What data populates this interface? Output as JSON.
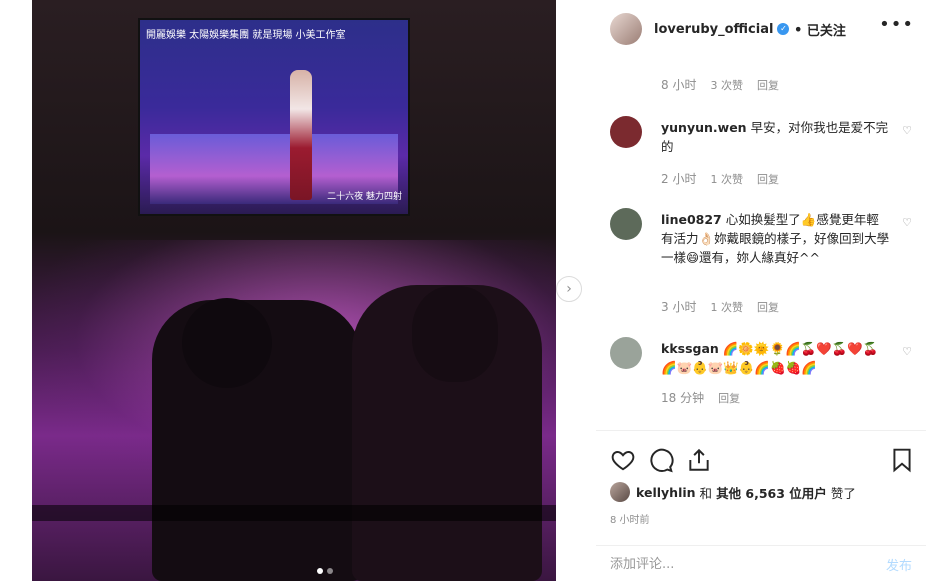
{
  "media": {
    "screen_caption": "開麗娛樂 太陽娛樂集團 就是現場 小美工作室",
    "screen_subtitle": "二十六夜 魅力四射",
    "carousel_next_icon": "chevron-right-icon",
    "carousel_dots": 2,
    "carousel_active_index": 0
  },
  "header": {
    "username": "loveruby_official",
    "bullet": "•",
    "follow_label": "已关注",
    "more_icon": "more-horizontal-icon"
  },
  "top_meta": {
    "time": "8 小时",
    "likes": "3 次赞",
    "reply": "回复"
  },
  "comments": [
    {
      "username": "yunyun.wen",
      "text": "早安，对你我也是爱不完的",
      "time": "2 小时",
      "likes": "1 次赞",
      "reply": "回复",
      "avatar_color": "#7b2a2f"
    },
    {
      "username": "line0827",
      "text": "心如换髮型了👍感覺更年輕有活力👌🏻妳戴眼鏡的樣子，好像回到大學一樣😄還有，妳人緣真好^^",
      "time": "3 小时",
      "likes": "1 次赞",
      "reply": "回复",
      "avatar_color": "#5d6a5a"
    },
    {
      "username": "kkssgan",
      "text": "🌈🌼🌞🌻🌈🍒❤️🍒❤️🍒🌈🐷👶🐷👑👶🌈🍓🍓🌈",
      "time": "18 分钟",
      "likes": "",
      "reply": "回复",
      "avatar_color": "#9aa39a"
    }
  ],
  "actions": {
    "like_icon": "heart-icon",
    "comment_icon": "comment-icon",
    "share_icon": "share-icon",
    "save_icon": "bookmark-icon"
  },
  "likes_summary": {
    "user": "kellyhlin",
    "connector": "和",
    "others": "其他 6,563 位用户",
    "suffix": "赞了"
  },
  "posted_time": "8 小时前",
  "comment_box": {
    "placeholder": "添加评论...",
    "publish_label": "发布"
  },
  "colors": {
    "verified": "#3897f0",
    "publish_disabled": "#b3dbff",
    "meta_gray": "#8e8e8e"
  }
}
